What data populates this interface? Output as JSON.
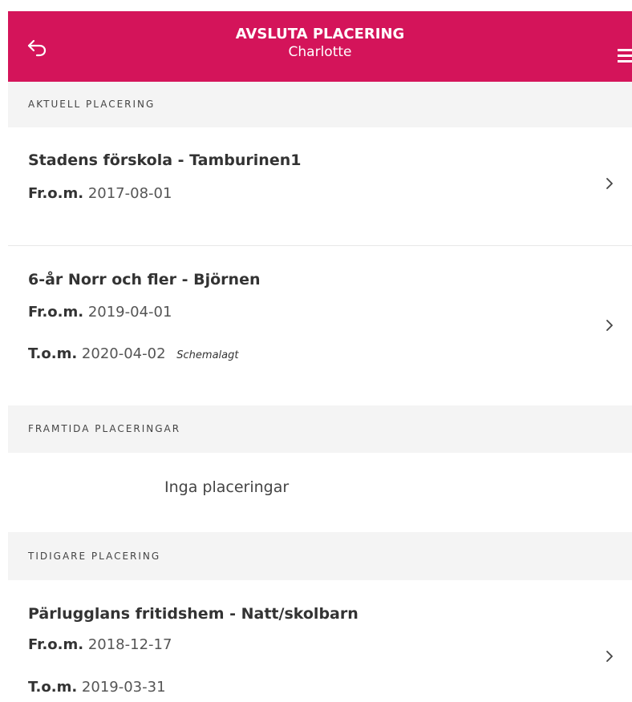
{
  "header": {
    "title": "AVSLUTA PLACERING",
    "subtitle": "Charlotte",
    "background_color": "#d4145a",
    "back_icon": "back-arrow-icon",
    "menu_icon": "hamburger-menu-icon"
  },
  "sections": {
    "current": {
      "label": "AKTUELL PLACERING",
      "items": [
        {
          "name": "Stadens förskola - Tamburinen1",
          "from_label": "Fr.o.m.",
          "from_date": "2017-08-01"
        },
        {
          "name": "6-år Norr och fler - Björnen",
          "from_label": "Fr.o.m.",
          "from_date": "2019-04-01",
          "to_label": "T.o.m.",
          "to_date": "2020-04-02",
          "badge": "Schemalagt"
        }
      ]
    },
    "future": {
      "label": "FRAMTIDA PLACERINGAR",
      "empty_text": "Inga placeringar"
    },
    "previous": {
      "label": "TIDIGARE PLACERING",
      "items": [
        {
          "name": "Pärlugglans fritidshem - Natt/skolbarn",
          "from_label": "Fr.o.m.",
          "from_date": "2018-12-17",
          "to_label": "T.o.m.",
          "to_date": "2019-03-31"
        }
      ]
    }
  }
}
